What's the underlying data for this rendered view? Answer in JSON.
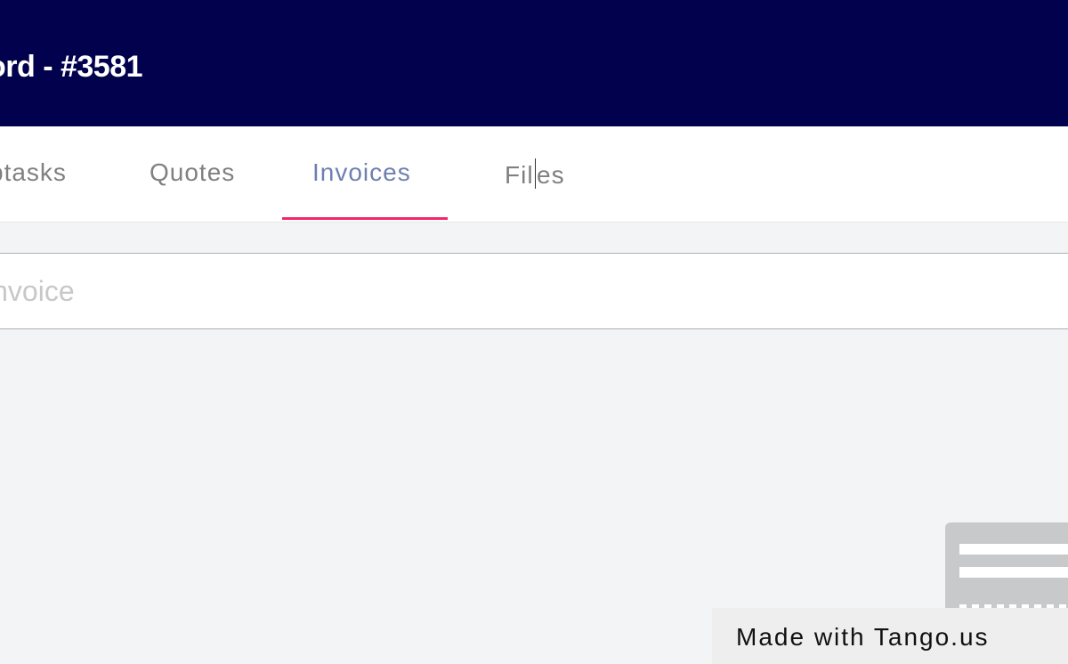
{
  "header": {
    "title": "ord - #3581"
  },
  "tabs": [
    {
      "label": "btasks",
      "active": false
    },
    {
      "label": "Quotes",
      "active": false
    },
    {
      "label": "Invoices",
      "active": true
    },
    {
      "label": "Files",
      "active": false
    }
  ],
  "search": {
    "placeholder": "invoice",
    "value": ""
  },
  "watermark": {
    "text": "Made with Tango.us"
  },
  "colors": {
    "header_bg": "#01014e",
    "active_tab": "#6f7fb2",
    "tab_underline": "#f3266b",
    "page_bg": "#f3f4f6"
  }
}
